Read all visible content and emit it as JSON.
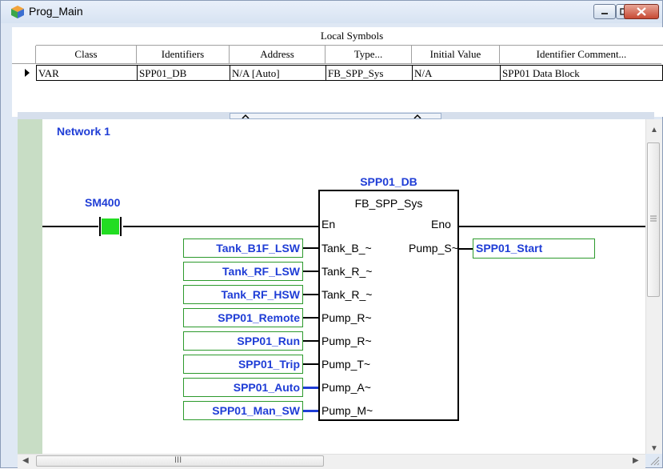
{
  "window": {
    "title": "Prog_Main",
    "minimize_label": "minimize",
    "restore_label": "restore",
    "close_label": "close"
  },
  "local_symbols": {
    "header": "Local Symbols",
    "columns": [
      "Class",
      "Identifiers",
      "Address",
      "Type...",
      "Initial Value",
      "Identifier Comment..."
    ],
    "row": {
      "class": "VAR",
      "identifier": "SPP01_DB",
      "address": "N/A [Auto]",
      "type": "FB_SPP_Sys",
      "initial_value": "N/A",
      "comment": "SPP01 Data Block"
    }
  },
  "ladder": {
    "network_label": "Network 1",
    "contact_label": "SM400",
    "fb_instance": "SPP01_DB",
    "fb_type": "FB_SPP_Sys",
    "en_pin": "En",
    "eno_pin": "Eno",
    "output_pin": "Pump_S~",
    "output_variable": "SPP01_Start",
    "inputs": [
      {
        "variable": "Tank_B1F_LSW",
        "pin": "Tank_B_~",
        "wire": "black"
      },
      {
        "variable": "Tank_RF_LSW",
        "pin": "Tank_R_~",
        "wire": "black"
      },
      {
        "variable": "Tank_RF_HSW",
        "pin": "Tank_R_~",
        "wire": "black"
      },
      {
        "variable": "SPP01_Remote",
        "pin": "Pump_R~",
        "wire": "black"
      },
      {
        "variable": "SPP01_Run",
        "pin": "Pump_R~",
        "wire": "black"
      },
      {
        "variable": "SPP01_Trip",
        "pin": "Pump_T~",
        "wire": "black"
      },
      {
        "variable": "SPP01_Auto",
        "pin": "Pump_A~",
        "wire": "blue"
      },
      {
        "variable": "SPP01_Man_SW",
        "pin": "Pump_M~",
        "wire": "blue"
      }
    ]
  },
  "scrollbars": {
    "h_thumb_glyph": "III"
  },
  "colors": {
    "identifier_blue": "#1f3dd6",
    "contact_green": "#22dd22",
    "box_green": "#2c9a2c",
    "rail_green": "#c8ddc5"
  }
}
